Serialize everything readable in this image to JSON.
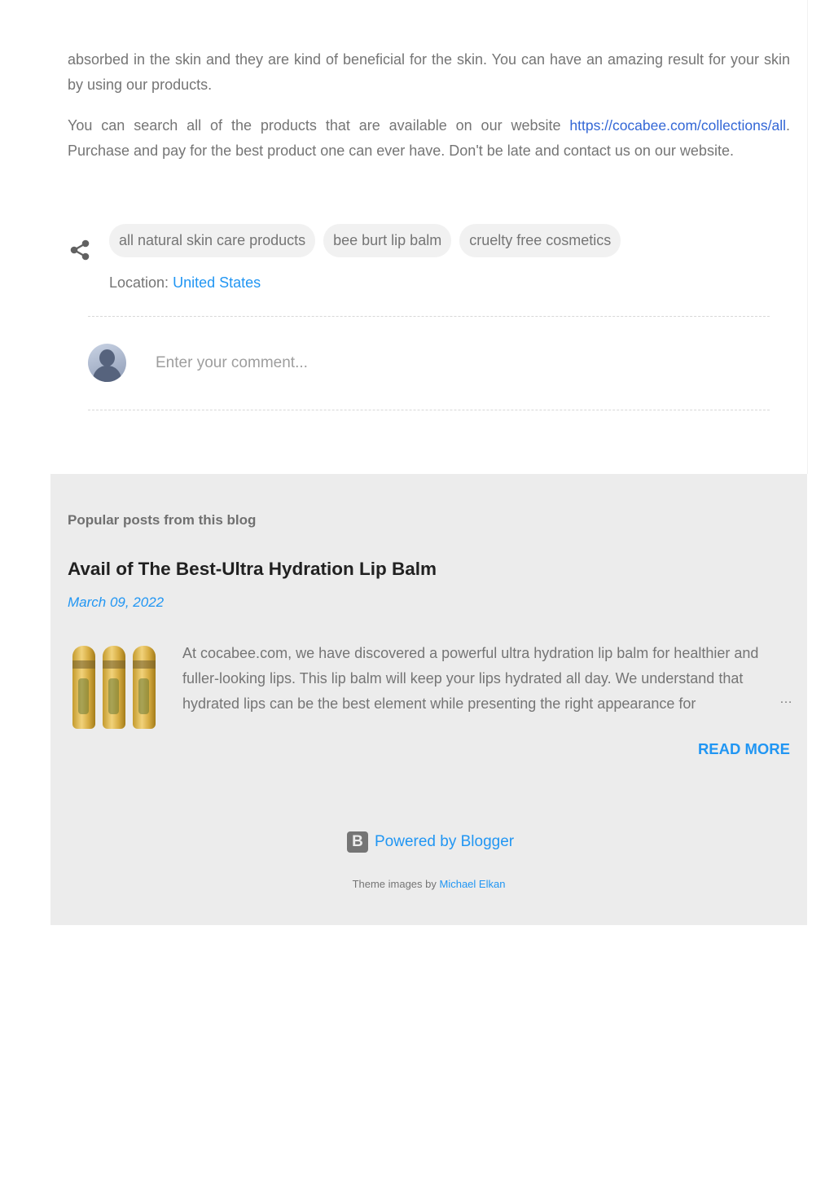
{
  "post": {
    "paragraph1": "absorbed in the skin and they are kind of beneficial for the skin. You can have an amazing result for your skin by using our products.",
    "paragraph2_before": "You can search all of the products that are available on our website ",
    "paragraph2_link": "https://cocabee.com/collections/all",
    "paragraph2_after": ". Purchase and pay for the best product one can ever have. Don't be late and contact us on our website."
  },
  "share": {
    "icon": "share-icon"
  },
  "labels": [
    "all natural skin care products",
    "bee burt lip balm",
    "cruelty free cosmetics"
  ],
  "location": {
    "label": "Location:",
    "value": "United States"
  },
  "comment": {
    "placeholder": "Enter your comment...",
    "avatar_icon": "user-avatar-icon"
  },
  "popular": {
    "heading": "Popular posts from this blog",
    "post": {
      "title": "Avail of The Best-Ultra Hydration Lip Balm",
      "date": "March 09, 2022",
      "snippet": "At cocabee.com, we have discovered a powerful ultra hydration lip balm for healthier and fuller-looking lips. This lip balm will keep your lips hydrated all day. We understand that hydrated lips can be the best element while presenting the right appearance for",
      "ellipsis": "…",
      "read_more": "READ MORE"
    }
  },
  "footer": {
    "powered_by": "Powered by Blogger",
    "blogger_icon_letter": "B",
    "theme_prefix": "Theme images by ",
    "theme_author": "Michael Elkan"
  },
  "colors": {
    "accent": "#2196f3",
    "link": "#3367d6",
    "popular_bg": "#ececec",
    "text": "#757575"
  }
}
